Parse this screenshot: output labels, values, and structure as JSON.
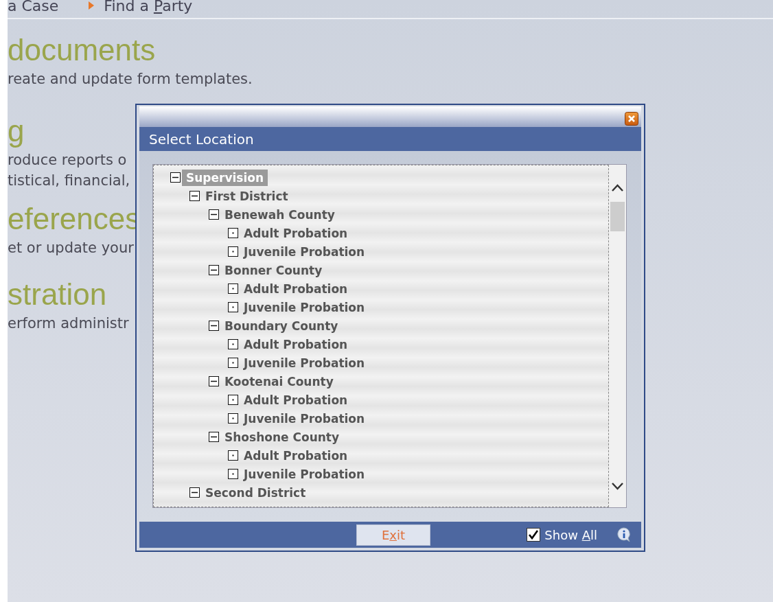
{
  "nav": [
    {
      "before": "a Case"
    },
    {
      "before": "Find a ",
      "key": "P",
      "after": "arty"
    }
  ],
  "sections": [
    {
      "heading": "documents",
      "lines": [
        "reate and update form templates."
      ]
    },
    {
      "heading": "g",
      "lines": [
        "roduce reports o",
        "tistical, financial,"
      ]
    },
    {
      "heading": "eferences",
      "lines": [
        "et or update your"
      ]
    },
    {
      "heading": "stration",
      "lines": [
        "erform administr"
      ]
    }
  ],
  "dialog": {
    "title": "Select Location",
    "tree": [
      {
        "label": "Supervision",
        "selected": true,
        "expanded": true,
        "children": [
          {
            "label": "First District",
            "selected": false,
            "expanded": true,
            "children": [
              {
                "label": "Benewah County",
                "selected": false,
                "expanded": true,
                "children": [
                  {
                    "label": "Adult Probation",
                    "selected": false
                  },
                  {
                    "label": "Juvenile Probation",
                    "selected": false
                  }
                ]
              },
              {
                "label": "Bonner County",
                "selected": false,
                "expanded": true,
                "children": [
                  {
                    "label": "Adult Probation",
                    "selected": false
                  },
                  {
                    "label": "Juvenile Probation",
                    "selected": false
                  }
                ]
              },
              {
                "label": "Boundary County",
                "selected": false,
                "expanded": true,
                "children": [
                  {
                    "label": "Adult Probation",
                    "selected": false
                  },
                  {
                    "label": "Juvenile Probation",
                    "selected": false
                  }
                ]
              },
              {
                "label": "Kootenai County",
                "selected": false,
                "expanded": true,
                "children": [
                  {
                    "label": "Adult Probation",
                    "selected": false
                  },
                  {
                    "label": "Juvenile Probation",
                    "selected": false
                  }
                ]
              },
              {
                "label": "Shoshone County",
                "selected": false,
                "expanded": true,
                "children": [
                  {
                    "label": "Adult Probation",
                    "selected": false
                  },
                  {
                    "label": "Juvenile Probation",
                    "selected": false
                  }
                ]
              }
            ]
          },
          {
            "label": "Second District",
            "selected": false,
            "expanded": true
          }
        ]
      }
    ],
    "exit_button": {
      "before": "E",
      "key": "x",
      "after": "it"
    },
    "show_all": {
      "checked": true,
      "before": "Show ",
      "key": "A",
      "after": "ll"
    }
  }
}
